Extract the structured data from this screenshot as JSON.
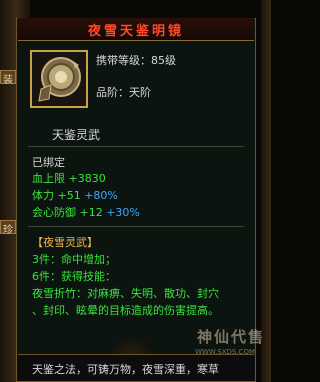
{
  "item": {
    "title": "夜雪天鉴明镜",
    "level_label": "携带等级：85级",
    "grade_label": "品阶：天阶",
    "name": "天鉴灵武",
    "bound": "已绑定",
    "stats": [
      {
        "name": "血上限",
        "value": "+3830",
        "extra": ""
      },
      {
        "name": "体力",
        "value": "+51",
        "extra": "+80%"
      },
      {
        "name": "会心防御",
        "value": "+12",
        "extra": "+30%"
      }
    ],
    "set_name": "【夜雪灵武】",
    "set_lines": [
      "3件：命中增加；",
      "6件：获得技能："
    ],
    "skill_text_1": "夜雪折竹：对麻痹、失明、散功、封穴",
    "skill_text_2": "、封印、眩晕的目标造成的伤害提高。",
    "description": "天鉴之法，可铸万物，夜雪深重，寒草"
  },
  "side": {
    "tab_top": "装",
    "tab_mid": "珍",
    "tab_bottom": "世"
  },
  "watermark": {
    "text": "神仙代售",
    "url": "WWW.SXDS.COM"
  },
  "colors": {
    "title": "#ff4a2a",
    "stat": "#39e33a",
    "percent": "#3ea6ff",
    "set": "#f2b84a"
  }
}
